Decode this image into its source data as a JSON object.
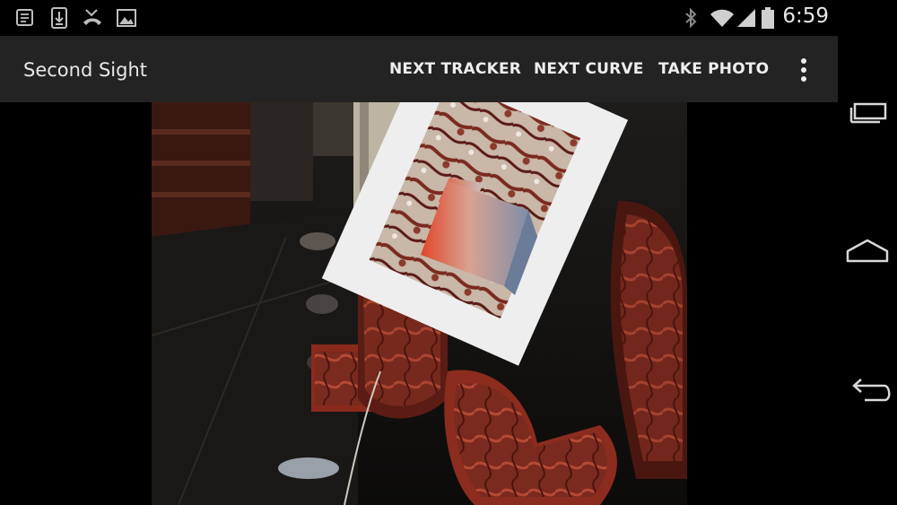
{
  "status_bar": {
    "notification_icons": [
      "notes-icon",
      "download-icon",
      "missed-call-icon",
      "image-icon"
    ],
    "system_icons": [
      "bluetooth-icon",
      "wifi-icon",
      "signal-icon",
      "battery-icon"
    ],
    "time": "6:59"
  },
  "action_bar": {
    "title": "Second Sight",
    "actions": {
      "next_tracker": "NEXT TRACKER",
      "next_curve": "NEXT CURVE",
      "take_photo": "TAKE PHOTO"
    },
    "overflow_icon": "more-vertical-icon"
  },
  "camera_view": {
    "scene": "camera preview with AR tracker image"
  },
  "nav_bar": {
    "buttons": [
      "recent-apps-icon",
      "home-icon",
      "back-icon"
    ]
  },
  "colors": {
    "status_bar_bg": "#000000",
    "action_bar_bg": "#232323",
    "text": "#eeeeee",
    "ar_gradient_start": "#e0452a",
    "ar_gradient_end": "#7f8fa8"
  }
}
